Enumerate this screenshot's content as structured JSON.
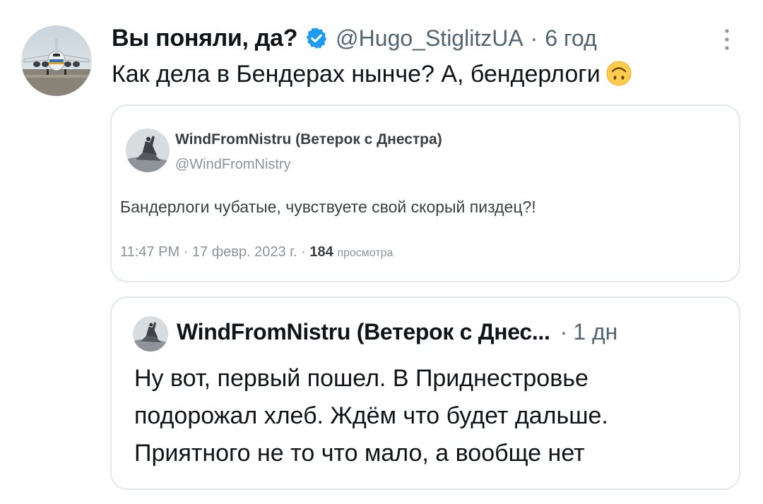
{
  "tweet": {
    "author_name": "Вы поняли, да?",
    "handle": "@Hugo_StiglitzUA",
    "separator": "·",
    "time": "6 год",
    "text": "Как дела в Бендерах нынче? А, бендерлоги",
    "emoji_icon": "upside-down-face-emoji",
    "verified_icon": "verified-badge-icon",
    "more_icon": "vertical-ellipsis-icon"
  },
  "quoted": {
    "name": "WindFromNistru (Ветерок с Днестра)",
    "handle": "@WindFromNistry",
    "text": "Бандерлоги чубатые, чувствуете свой скорый пиздец?!",
    "meta": "11:47 PM · 17 февр. 2023 г. · ",
    "views_count": "184",
    "views_label": "просмотра"
  },
  "reply": {
    "name": "WindFromNistru (Ветерок с Днес...",
    "separator": "·",
    "time": "1 дн",
    "lines": [
      "Ну вот, первый пошел. В Приднестровье",
      "подорожал хлеб. Ждём что будет дальше.",
      "Приятного не то что мало, а вообще нет"
    ]
  },
  "colors": {
    "text_primary": "#0f1419",
    "text_secondary": "#536471",
    "verified_blue": "#1d9bf0",
    "card_border": "#e3e8ec"
  }
}
